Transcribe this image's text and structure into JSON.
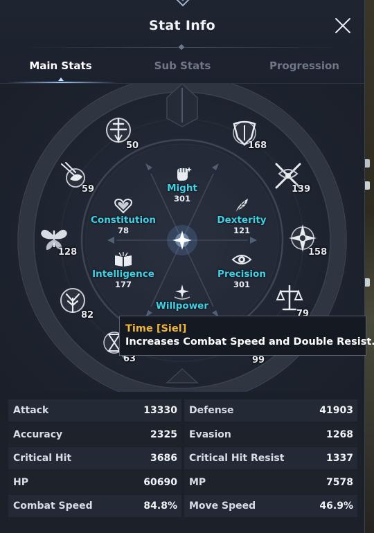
{
  "window": {
    "title": "Stat Info",
    "close_label": "Close"
  },
  "tabs": [
    {
      "label": "Main Stats",
      "active": true
    },
    {
      "label": "Sub Stats",
      "active": false
    },
    {
      "label": "Progression",
      "active": false
    }
  ],
  "outer_nodes": [
    {
      "icon": "sword-crest-icon",
      "value": "50"
    },
    {
      "icon": "winged-helm-icon",
      "value": "168"
    },
    {
      "icon": "crossed-blades-icon",
      "value": "139"
    },
    {
      "icon": "compass-star-icon",
      "value": "158"
    },
    {
      "icon": "scales-icon",
      "value": "79"
    },
    {
      "icon": "ring-emblem-icon",
      "value": "99"
    },
    {
      "icon": "hourglass-shard-icon",
      "value": "63"
    },
    {
      "icon": "tree-of-life-icon",
      "value": "82"
    },
    {
      "icon": "butterfly-icon",
      "value": "128"
    },
    {
      "icon": "comet-bird-icon",
      "value": "59"
    }
  ],
  "main_stats": [
    {
      "name": "Might",
      "value": "301",
      "icon": "fist-icon"
    },
    {
      "name": "Dexterity",
      "value": "121",
      "icon": "feather-icon"
    },
    {
      "name": "Precision",
      "value": "301",
      "icon": "eye-icon"
    },
    {
      "name": "Willpower",
      "value": "",
      "icon": "star-burst-icon"
    },
    {
      "name": "Intelligence",
      "value": "177",
      "icon": "book-icon"
    },
    {
      "name": "Constitution",
      "value": "78",
      "icon": "heart-icon"
    }
  ],
  "tooltip": {
    "title": "Time [Siel]",
    "description": "Increases Combat Speed and Double Resist."
  },
  "stats_rows": [
    {
      "left_label": "Attack",
      "left_value": "13330",
      "right_label": "Defense",
      "right_value": "41903"
    },
    {
      "left_label": "Accuracy",
      "left_value": "2325",
      "right_label": "Evasion",
      "right_value": "1268"
    },
    {
      "left_label": "Critical Hit",
      "left_value": "3686",
      "right_label": "Critical Hit Resist",
      "right_value": "1337"
    },
    {
      "left_label": "HP",
      "left_value": "60690",
      "right_label": "MP",
      "right_value": "7578"
    },
    {
      "left_label": "Combat Speed",
      "left_value": "84.8%",
      "right_label": "Move Speed",
      "right_value": "46.9%"
    }
  ],
  "colors": {
    "stat_name": "#3fd2e6",
    "tooltip_title": "#f0b53a",
    "panel_bg": "#1e2430"
  }
}
